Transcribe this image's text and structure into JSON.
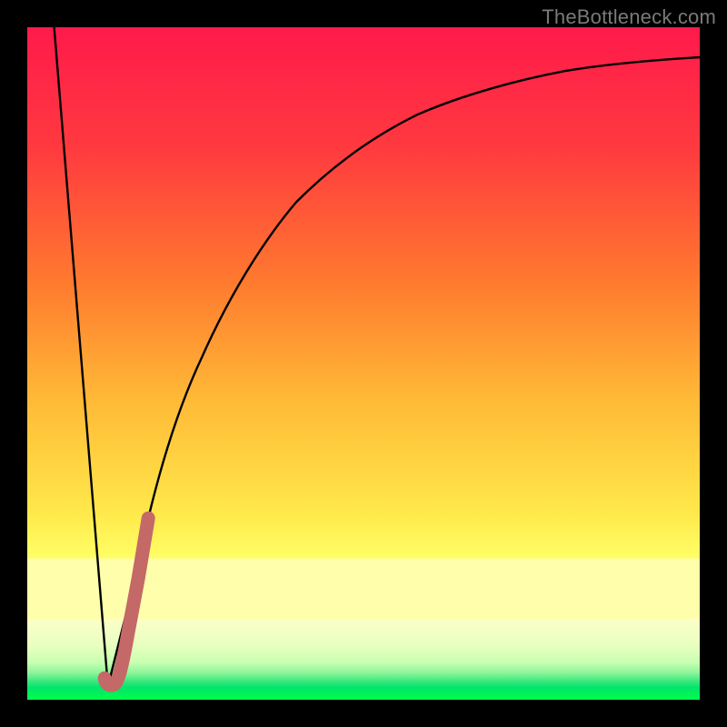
{
  "attribution": "TheBottleneck.com",
  "colors": {
    "frame": "#000000",
    "curve": "#000000",
    "marker": "#c46868",
    "grad_top": "#ff1a4b",
    "grad_mid1": "#ff7a2f",
    "grad_mid2": "#ffd23b",
    "grad_mid3": "#ffff66",
    "pale_yellow": "#ffffb0",
    "pale_green": "#d9ffb8",
    "green_band": "#00e66b",
    "bright_green": "#00ff55"
  },
  "chart_data": {
    "type": "line",
    "title": "",
    "xlabel": "",
    "ylabel": "",
    "xlim": [
      0,
      100
    ],
    "ylim": [
      0,
      100
    ],
    "series": [
      {
        "name": "left-descent",
        "x": [
          4,
          12
        ],
        "values": [
          100,
          2
        ]
      },
      {
        "name": "right-rise",
        "x": [
          12,
          15,
          18,
          22,
          26,
          30,
          35,
          40,
          46,
          52,
          58,
          65,
          72,
          80,
          88,
          95,
          100
        ],
        "values": [
          2,
          14,
          27,
          40,
          51,
          60,
          68,
          74,
          79,
          83,
          85.5,
          87.5,
          89,
          90.2,
          91.2,
          92,
          92.6
        ]
      },
      {
        "name": "marker-hook",
        "x": [
          11.5,
          12.2,
          13.5,
          15,
          16.5,
          18
        ],
        "values": [
          3.2,
          2.2,
          3.2,
          10,
          18,
          27
        ]
      }
    ],
    "notes": "Values read off the chart visually; y is percentage height from bottom of plot area, x is percentage width from left. No axis ticks or labels are present in the image."
  }
}
